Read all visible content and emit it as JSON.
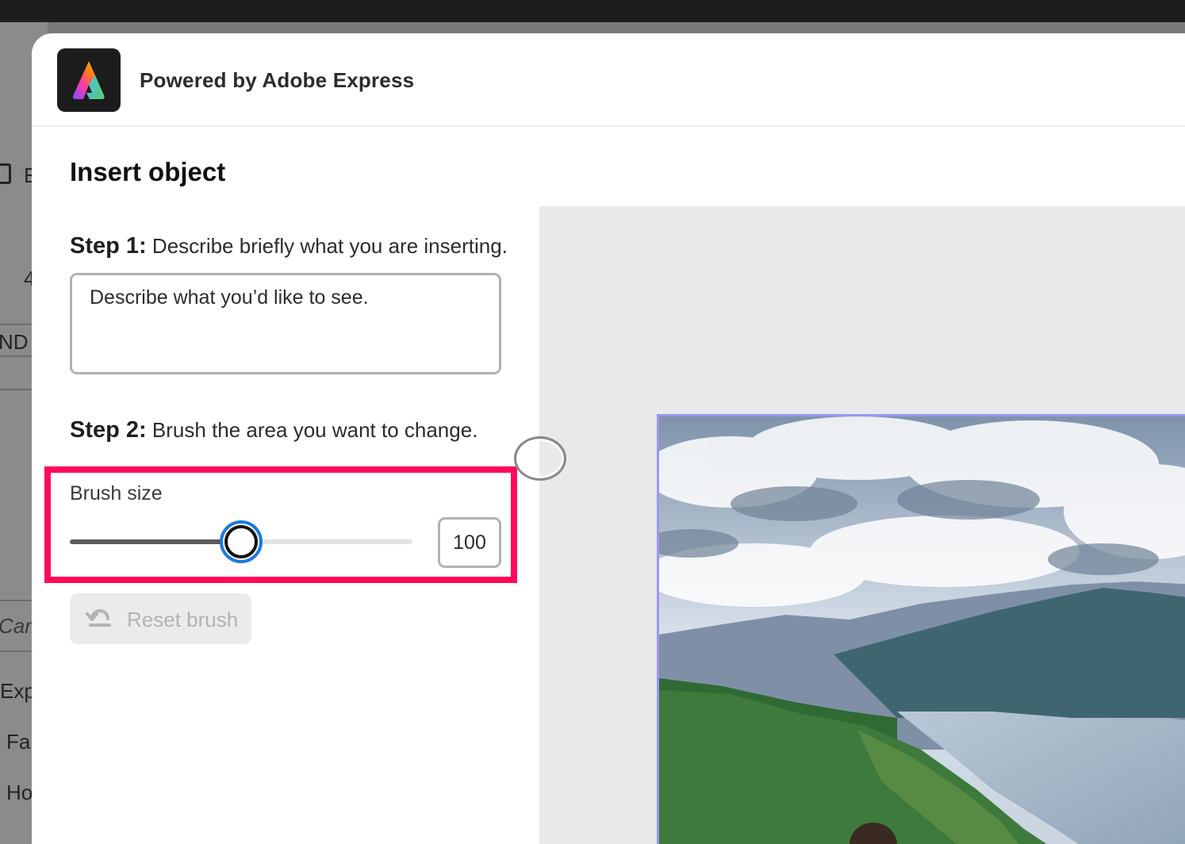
{
  "background_app": {
    "items": [
      "E",
      "4",
      "ND -",
      "Cam",
      "Exp",
      "Fal",
      "Ho"
    ]
  },
  "header": {
    "logo_icon": "adobe-express-logo",
    "powered_by": "Powered by Adobe Express"
  },
  "panel": {
    "title": "Insert object",
    "step1": {
      "label": "Step 1:",
      "text": "Describe briefly what you are inserting.",
      "placeholder": "Describe what you’d like to see."
    },
    "step2": {
      "label": "Step 2:",
      "text": "Brush the area you want to change."
    },
    "brush": {
      "label": "Brush size",
      "value": "100",
      "slider_fraction": 0.5
    },
    "reset": {
      "icon": "reset-icon",
      "label": "Reset brush"
    }
  },
  "colors": {
    "highlight": "#ff0a5a",
    "slider_handle_ring": "#1a7ae0",
    "photo_border": "#9b97f2"
  }
}
